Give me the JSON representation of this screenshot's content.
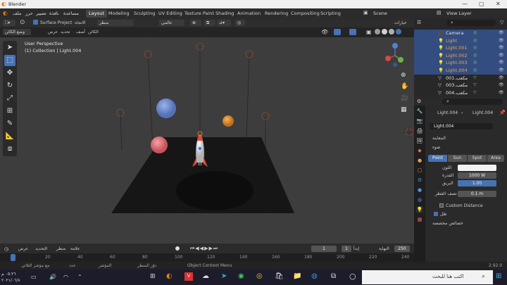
{
  "window": {
    "title": "Blender",
    "controls": [
      "—",
      "▢",
      "✕"
    ]
  },
  "menu": [
    "ملف",
    "حرر",
    "تصيير",
    "نافذة",
    "مساعدة"
  ],
  "workspace_tabs": [
    "Layout",
    "Modeling",
    "Sculpting",
    "UV Editing",
    "Texture Paint",
    "Shading",
    "Animation",
    "Rendering",
    "Compositing",
    "Scripting"
  ],
  "active_tab": "Layout",
  "scene": {
    "label": "Scene",
    "view_layer": "View Layer"
  },
  "header": {
    "mode": "وضع الكائن",
    "menus": [
      "عرض",
      "تحديد",
      "أضف",
      "الكائن"
    ],
    "transform": "منظر",
    "orientation": "الاتجاه",
    "surface_project": "Surface Project",
    "global": "عالمي",
    "options": "خيارات"
  },
  "viewport": {
    "perspective": "User Perspective",
    "collection": "(1) Collection | Light.004"
  },
  "outliner": {
    "items": [
      {
        "name": "Camera",
        "type": "camera",
        "selected": true
      },
      {
        "name": "Light",
        "type": "light",
        "selected": true
      },
      {
        "name": "Light.001",
        "type": "light",
        "selected": true
      },
      {
        "name": "Light.002",
        "type": "light",
        "selected": true
      },
      {
        "name": "Light.003",
        "type": "light",
        "selected": true
      },
      {
        "name": "Light.004",
        "type": "light",
        "selected": true
      },
      {
        "name": "مكعب.001",
        "type": "mesh",
        "selected": false
      },
      {
        "name": "مكعب.003",
        "type": "mesh",
        "selected": false
      },
      {
        "name": "مكعب.004",
        "type": "mesh",
        "selected": false
      }
    ]
  },
  "properties": {
    "object_name": "Light.004",
    "data_name": "Light.004",
    "datablock": "Light.004",
    "preview": "المعاينة",
    "light_section": "ضوء",
    "types": [
      "Point",
      "Sun",
      "Spot",
      "Area"
    ],
    "active_type": "Point",
    "color_label": "اللون",
    "power_label": "القدرة",
    "power": "1000 W",
    "specular_label": "البريق",
    "specular": "1.00",
    "radius_label": "نصف القطر",
    "radius": "0.1 m",
    "custom_distance": "Custom Distance",
    "shadow": "ظل",
    "custom_props": "خصائص مخصصة"
  },
  "timeline": {
    "menus": [
      "عرض",
      "التحديد",
      "منظر",
      "علامة"
    ],
    "frame": "1",
    "start_label": "إبدأ",
    "start": "1",
    "end_label": "النهاية",
    "end": "250",
    "ticks": [
      "0",
      "20",
      "40",
      "60",
      "80",
      "100",
      "120",
      "140",
      "160",
      "180",
      "200",
      "220",
      "240"
    ]
  },
  "status": {
    "items": [
      "حدد",
      "المؤشر",
      "دوّر المنظر",
      "Object Context Menu"
    ],
    "left_text": "مع مؤشر الثلاثي",
    "version": "2.92.0"
  },
  "taskbar": {
    "search": "اكتب هنا للبحث",
    "time": "٠٥:٢٦ م",
    "date": "٢٠٢١/٠٦/٨"
  },
  "colors": {
    "accent": "#4772b3",
    "selection": "#334d80",
    "light": "#f4a14a"
  }
}
